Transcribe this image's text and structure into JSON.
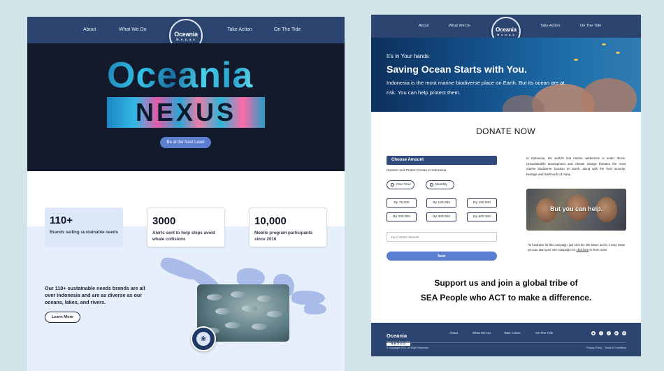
{
  "left_page": {
    "nav": {
      "items": [
        "About",
        "What We Do",
        "Take Action",
        "On The Tide"
      ],
      "logo_title": "Oceania",
      "logo_sub": "N.e.x.u.s"
    },
    "hero": {
      "word1": "Oceania",
      "word2": "NEXUS",
      "cta": "Be at the Next Level"
    },
    "stats": [
      {
        "value": "110+",
        "label": "Brands selling sustainable needs"
      },
      {
        "value": "3000",
        "label": "Alerts sent to help ships avoid whale collisions"
      },
      {
        "value": "10,000",
        "label": "Mobile program participants since 2016"
      }
    ],
    "about": {
      "text": "Our 110+ sustainable needs brands are all over Indonesia and are as diverse as our oceans, lakes, and rivers.",
      "button": "Learn More"
    }
  },
  "right_page": {
    "nav": {
      "items": [
        "About",
        "What We Do",
        "Take Action",
        "On The Tide"
      ],
      "logo_title": "Oceania",
      "logo_sub": "N.e.x.u.s"
    },
    "hero": {
      "kicker": "It's in Your hands",
      "headline": "Saving Ocean Starts with You.",
      "sub": "Indonesia is the most marine biodiverse place on Earth. But its ocean are at risk. You can help protect them."
    },
    "donate": {
      "title": "DONATE NOW",
      "amount_header": "Choose Amount",
      "note": "Restore and Protect Ocean in Indonesia.",
      "frequency": [
        "One Time",
        "Monthly"
      ],
      "amounts": [
        "Rp 75.000",
        "Rp 100.000",
        "Rp 150.000",
        "Rp 200.000",
        "Rp 300.000",
        "Rp 500.000"
      ],
      "custom_placeholder": "Rp Custom amount",
      "next": "Next"
    },
    "side": {
      "paragraph": "In Indonesia, the world's last marine wilderness is under threat. Unsustainable development and climate change threaten the most marine biodiverse location on Earth, along with the food security, heritage and livelihoods of many.",
      "photo_caption": "But you can help.",
      "fine_print_a": "*to fundraise for this campaign, just click the link above and in 2 easy steps you can start your own campaign! Or ",
      "fine_print_link": "click here",
      "fine_print_b": " to learn more."
    },
    "support": {
      "line1": "Support us and join a global tribe of",
      "line2": "SEA People who ACT to make a difference."
    },
    "footer": {
      "logo_title": "Oceania",
      "logo_sub": "NEXUS",
      "links": [
        "About",
        "What We Do",
        "Take Action",
        "On The Tide"
      ],
      "copyright": "© Copyright 2023. All Right Reserved.",
      "privacy": "Privacy Policy",
      "terms": "Terms & Conditions",
      "social_icons": [
        "instagram-icon",
        "facebook-icon",
        "twitter-icon",
        "youtube-icon",
        "mail-icon"
      ]
    }
  },
  "colors": {
    "navy": "#2b4470",
    "accent": "#5b7ed1",
    "hero_dark": "#121a2c",
    "light_blue": "#e6effb"
  }
}
